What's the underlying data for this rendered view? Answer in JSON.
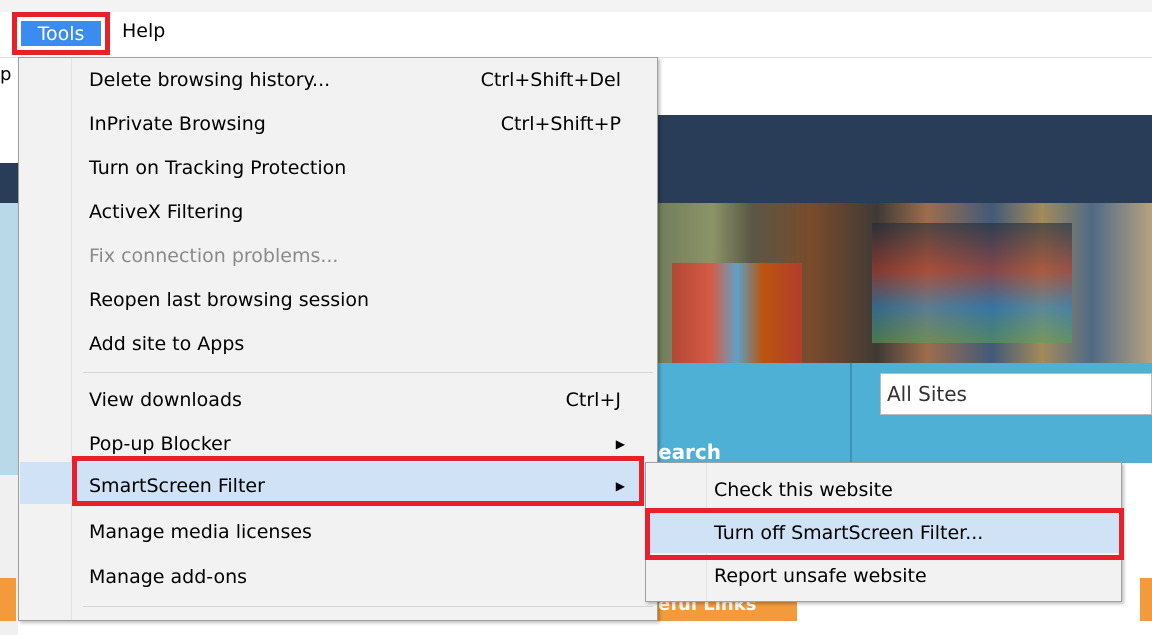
{
  "menubar": {
    "tools_label": "Tools",
    "help_label": "Help"
  },
  "left_fragments": {
    "cmd_fragment": "p"
  },
  "tools_menu": {
    "items": [
      {
        "label": "Delete browsing history...",
        "shortcut": "Ctrl+Shift+Del"
      },
      {
        "label": "InPrivate Browsing",
        "shortcut": "Ctrl+Shift+P"
      },
      {
        "label": "Turn on Tracking Protection",
        "shortcut": ""
      },
      {
        "label": "ActiveX Filtering",
        "shortcut": ""
      },
      {
        "label": "Fix connection problems...",
        "shortcut": "",
        "disabled": true
      },
      {
        "label": "Reopen last browsing session",
        "shortcut": ""
      },
      {
        "label": "Add site to Apps",
        "shortcut": ""
      },
      {
        "label": "View downloads",
        "shortcut": "Ctrl+J"
      },
      {
        "label": "Pop-up Blocker",
        "shortcut": "",
        "submenu": true
      },
      {
        "label": "SmartScreen Filter",
        "shortcut": "",
        "submenu": true,
        "highlighted": true
      },
      {
        "label": "Manage media licenses",
        "shortcut": ""
      },
      {
        "label": "Manage add-ons",
        "shortcut": ""
      }
    ]
  },
  "smartscreen_submenu": {
    "items": [
      {
        "label": "Check this website"
      },
      {
        "label": "Turn off SmartScreen Filter...",
        "highlighted": true
      },
      {
        "label": "Report unsafe website"
      }
    ]
  },
  "page": {
    "search_scope": "All Sites",
    "search_label": "earch",
    "links_label": "eful Links"
  },
  "colors": {
    "highlight_box": "#e8202a",
    "menu_selection": "#cfe2f6",
    "tools_active": "#3a8cf0",
    "site_header": "#2a3d58",
    "site_blue": "#4fb0d6",
    "site_orange": "#f39a3d"
  },
  "icons": {
    "submenu_arrow": "chevron-right-icon"
  }
}
